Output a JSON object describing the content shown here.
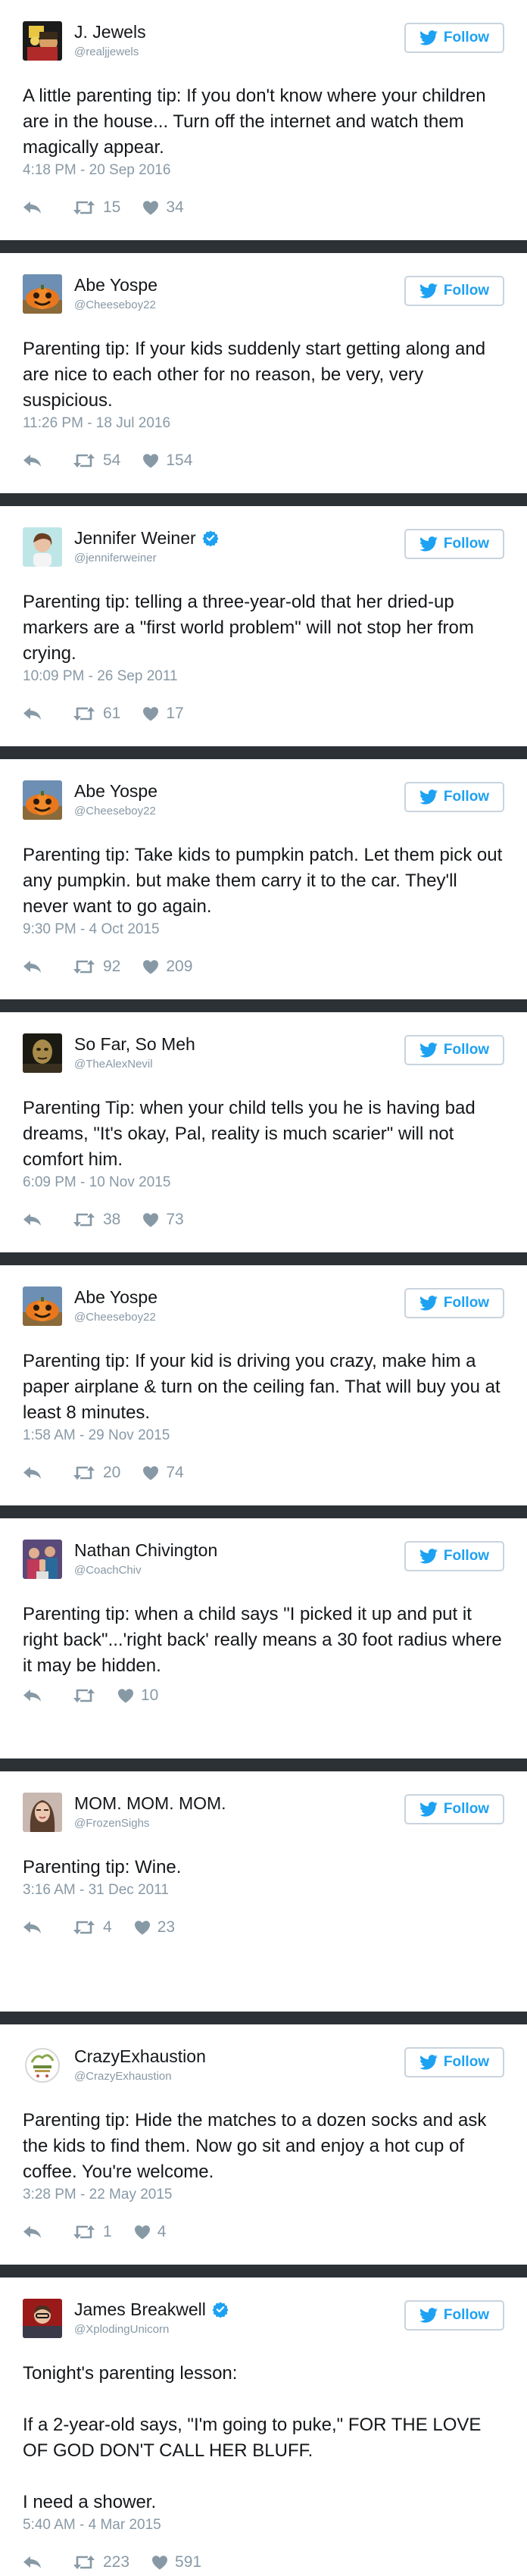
{
  "follow_label": "Follow",
  "colors": {
    "accent": "#1da1f2",
    "muted": "#8899a6",
    "separator": "#2c3136"
  },
  "tweets": [
    {
      "name": "J. Jewels",
      "handle": "@realjjewels",
      "verified": false,
      "avatar": "avatar-jjewels",
      "paragraphs": [
        "A little parenting tip: If you don't know where your children are in the house... Turn off the internet and watch them magically appear."
      ],
      "time": "4:18 PM - 20 Sep 2016",
      "retweets": "15",
      "likes": "34"
    },
    {
      "name": "Abe Yospe",
      "handle": "@Cheeseboy22",
      "verified": false,
      "avatar": "avatar-pumpkin",
      "paragraphs": [
        "Parenting tip: If your kids suddenly start getting along and are nice to each other for no reason, be very, very suspicious."
      ],
      "time": "11:26 PM - 18 Jul 2016",
      "retweets": "54",
      "likes": "154"
    },
    {
      "name": "Jennifer Weiner",
      "handle": "@jenniferweiner",
      "verified": true,
      "avatar": "avatar-jennifer",
      "paragraphs": [
        "Parenting tip: telling a three-year-old that her dried-up markers are a \"first world problem\" will not stop her from crying."
      ],
      "time": "10:09 PM - 26 Sep 2011",
      "retweets": "61",
      "likes": "17"
    },
    {
      "name": "Abe Yospe",
      "handle": "@Cheeseboy22",
      "verified": false,
      "avatar": "avatar-pumpkin",
      "paragraphs": [
        "Parenting tip: Take kids to pumpkin patch. Let them pick out any pumpkin. but make them carry it to the car. They'll never want to go again."
      ],
      "time": "9:30 PM - 4 Oct 2015",
      "retweets": "92",
      "likes": "209"
    },
    {
      "name": "So Far, So Meh",
      "handle": "@TheAlexNevil",
      "verified": false,
      "avatar": "avatar-sofar",
      "paragraphs": [
        "Parenting Tip: when your child tells you he is having bad dreams, \"It's okay, Pal, reality is much scarier\" will not comfort him."
      ],
      "time": "6:09 PM - 10 Nov 2015",
      "retweets": "38",
      "likes": "73"
    },
    {
      "name": "Abe Yospe",
      "handle": "@Cheeseboy22",
      "verified": false,
      "avatar": "avatar-pumpkin",
      "paragraphs": [
        "Parenting tip: If your kid is driving you crazy, make him a paper airplane & turn on the ceiling fan. That will buy you at least 8 minutes."
      ],
      "time": "1:58 AM - 29 Nov 2015",
      "retweets": "20",
      "likes": "74"
    },
    {
      "name": "Nathan Chivington",
      "handle": "@CoachChiv",
      "verified": false,
      "avatar": "avatar-nathan",
      "paragraphs": [
        "Parenting tip: when a child says \"I picked it up and put it right back\"...'right back' really means a 30 foot radius where it may be hidden."
      ],
      "time": "",
      "retweets": "",
      "likes": "10"
    },
    {
      "name": "MOM. MOM. MOM.",
      "handle": "@FrozenSighs",
      "verified": false,
      "avatar": "avatar-mom",
      "paragraphs": [
        "Parenting tip: Wine."
      ],
      "time": "3:16 AM - 31 Dec 2011",
      "retweets": "4",
      "likes": "23"
    },
    {
      "name": "CrazyExhaustion",
      "handle": "@CrazyExhaustion",
      "verified": false,
      "avatar": "avatar-crazy",
      "paragraphs": [
        "Parenting tip: Hide the matches to a dozen socks and ask the kids to find them. Now go sit and enjoy a hot cup of coffee. You're welcome."
      ],
      "time": "3:28 PM - 22 May 2015",
      "retweets": "1",
      "likes": "4"
    },
    {
      "name": "James Breakwell",
      "handle": "@XplodingUnicorn",
      "verified": true,
      "avatar": "avatar-james",
      "paragraphs": [
        "Tonight's parenting lesson:",
        "If a 2-year-old says, \"I'm going to puke,\" FOR THE LOVE OF GOD DON'T CALL HER BLUFF.",
        "I need a shower."
      ],
      "time": "5:40 AM - 4 Mar 2015",
      "retweets": "223",
      "likes": "591"
    }
  ]
}
